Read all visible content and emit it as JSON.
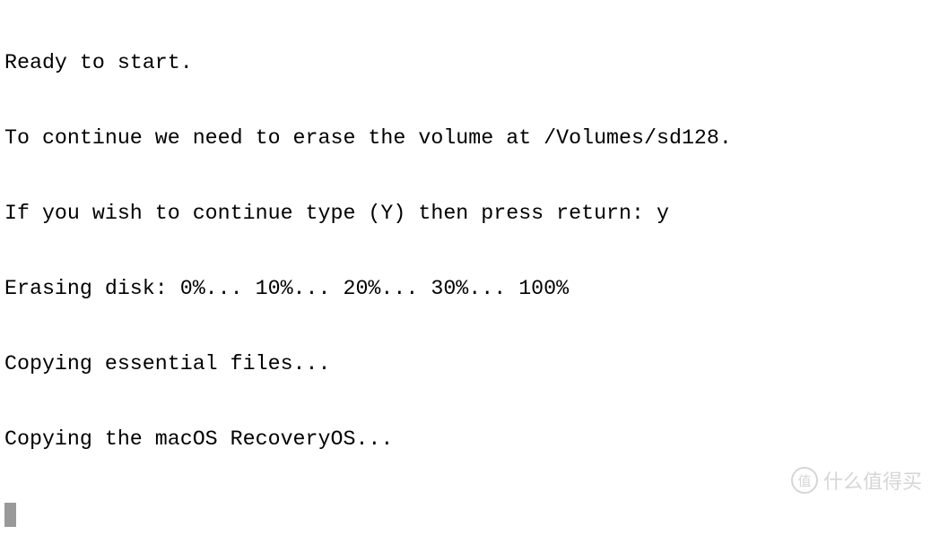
{
  "terminal": {
    "lines": [
      "Ready to start.",
      "To continue we need to erase the volume at /Volumes/sd128.",
      "If you wish to continue type (Y) then press return: y",
      "Erasing disk: 0%... 10%... 20%... 30%... 100%",
      "Copying essential files...",
      "Copying the macOS RecoveryOS..."
    ],
    "cursor_color": "#999999"
  },
  "watermark": {
    "seal": "值",
    "text": "什么值得买"
  }
}
